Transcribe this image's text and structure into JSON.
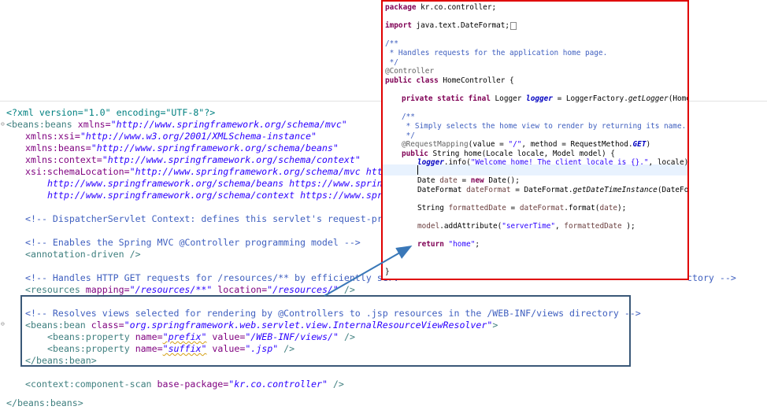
{
  "xml": {
    "l1_decl": "<?xml version=\"1.0\" encoding=\"UTF-8\"?>",
    "l2_tag": "<beans:beans ",
    "l2_attr": "xmlns=",
    "l2_val": "\"http://www.springframework.org/schema/mvc\"",
    "l3_attr": "xmlns:xsi=",
    "l3_val": "\"http://www.w3.org/2001/XMLSchema-instance\"",
    "l4_attr": "xmlns:beans=",
    "l4_val": "\"http://www.springframework.org/schema/beans\"",
    "l5_attr": "xmlns:context=",
    "l5_val": "\"http://www.springframework.org/schema/context\"",
    "l6_attr": "xsi:schemaLocation=",
    "l6_val": "\"http://www.springframework.org/schema/mvc https:",
    "l7_val": "http://www.springframework.org/schema/beans https://www.springf",
    "l8_val": "http://www.springframework.org/schema/context https://www.spring",
    "l10_comment": "<!-- DispatcherServlet Context: defines this servlet's request-proce",
    "l12_comment": "<!-- Enables the Spring MVC @Controller programming model -->",
    "l13_tag": "<annotation-driven />",
    "l15_comment_a": "<!-- Handles HTTP GET requests for /resources/** by efficiently serv",
    "l15_comment_b": "ctory -->",
    "l16_tag": "<resources ",
    "l16_attr1": "mapping=",
    "l16_val1": "\"/resources/**\"",
    "l16_attr2": " location=",
    "l16_val2": "\"/resources/\"",
    "l16_end": " />",
    "l18_comment": "<!-- Resolves views selected for rendering by @Controllers to .jsp resources in the /WEB-INF/views directory -->",
    "l19_tag": "<beans:bean ",
    "l19_attr": "class=",
    "l19_val": "\"org.springframework.web.servlet.view.InternalResourceViewResolver\"",
    "l19_end": ">",
    "l20_tag": "<beans:property ",
    "l20_attr1": "name=",
    "l20_val1": "\"prefix\"",
    "l20_attr2": " value=",
    "l20_val2": "\"/WEB-INF/views/\"",
    "l20_end": " />",
    "l21_tag": "<beans:property ",
    "l21_attr1": "name=",
    "l21_val1": "\"suffix\"",
    "l21_attr2": " value=",
    "l21_val2": "\".jsp\"",
    "l21_end": " />",
    "l22_tag": "</beans:bean>",
    "l24_tag": "<context:component-scan ",
    "l24_attr": "base-package=",
    "l24_val": "\"kr.co.controller\"",
    "l24_end": " />",
    "l26_tag": "</beans:beans>"
  },
  "java": {
    "pkg_kw": "package",
    "pkg_name": " kr.co.controller;",
    "imp_kw": "import",
    "imp_name": " java.text.DateFormat;",
    "jd1": "/**",
    "jd2": " * Handles requests for the application home page.",
    "jd3": " */",
    "ann_controller": "@Controller",
    "cls_kw": "public class",
    "cls_name": " HomeController {",
    "f_kw": "private static final",
    "f_type": " Logger ",
    "f_name": "logger",
    "f_rest1": " = LoggerFactory.",
    "f_method": "getLogger",
    "f_rest2": "(HomeContr",
    "jd4": "/**",
    "jd5": " * Simply selects the home view to render by returning its name.",
    "jd6": " */",
    "ann_rm": "@RequestMapping",
    "rm_rest1": "(value = ",
    "rm_str": "\"/\"",
    "rm_rest2": ", method = RequestMethod.",
    "rm_get": "GET",
    "rm_rest3": ")",
    "m_kw": "public",
    "m_sig": " String home(Locale locale, Model model) {",
    "log_obj": "logger",
    "log_rest1": ".info(",
    "log_str": "\"Welcome home! The client locale is {}.\"",
    "log_rest2": ", locale);",
    "d_type": "Date ",
    "d_var": "date",
    "d_eq": " = ",
    "d_new": "new",
    "d_rest": " Date();",
    "df_type": "DateFormat ",
    "df_var": "dateFormat",
    "df_rest1": " = DateFormat.",
    "df_method": "getDateTimeInstance",
    "df_rest2": "(DateFormat.",
    "fd_type": "String ",
    "fd_var": "formattedDate",
    "fd_rest1": " = ",
    "fd_obj": "dateFormat",
    "fd_rest2": ".format(",
    "fd_arg": "date",
    "fd_rest3": ");",
    "ma_obj": "model",
    "ma_rest1": ".addAttribute(",
    "ma_str": "\"serverTime\"",
    "ma_rest2": ", ",
    "ma_arg": "formattedDate",
    "ma_rest3": " );",
    "ret_kw": "return",
    "ret_str": " \"home\"",
    "ret_end": ";",
    "close_brace": "}"
  },
  "colors": {
    "java_box_border": "#e00000",
    "highlight_box_border": "#3a5878",
    "arrow": "#3a78b8"
  }
}
